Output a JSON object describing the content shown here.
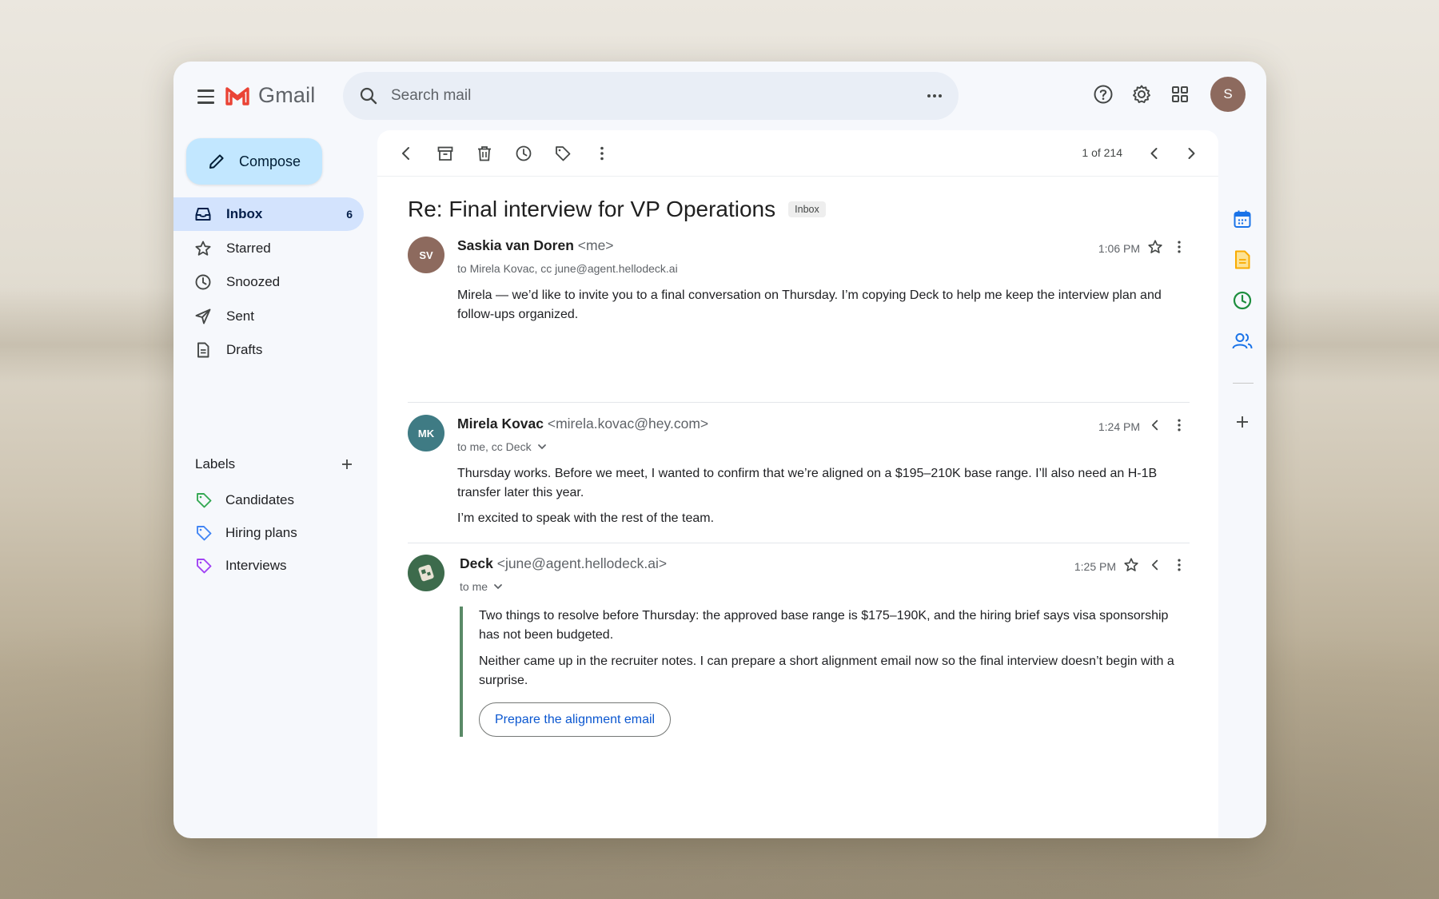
{
  "app": {
    "name": "Gmail"
  },
  "search": {
    "placeholder": "Search mail"
  },
  "user": {
    "avatar_initial": "S",
    "avatar_color": "#8d6a5e"
  },
  "compose": {
    "label": "Compose"
  },
  "nav": {
    "items": [
      {
        "label": "Inbox",
        "count": "6",
        "icon": "inbox-icon",
        "active": true
      },
      {
        "label": "Starred",
        "icon": "star-icon"
      },
      {
        "label": "Snoozed",
        "icon": "clock-icon"
      },
      {
        "label": "Sent",
        "icon": "send-icon"
      },
      {
        "label": "Drafts",
        "icon": "draft-icon"
      }
    ]
  },
  "labels": {
    "heading": "Labels",
    "items": [
      {
        "label": "Candidates",
        "color": "#34a853"
      },
      {
        "label": "Hiring plans",
        "color": "#4285f4"
      },
      {
        "label": "Interviews",
        "color": "#a142f4"
      }
    ]
  },
  "toolbar": {
    "pager": "1 of 214"
  },
  "thread": {
    "subject": "Re: Final interview for VP Operations",
    "badge": "Inbox",
    "messages": [
      {
        "initials": "SV",
        "avatar_color": "#8d6a5e",
        "sender": "Saskia van Doren",
        "address": "<me>",
        "to": "to Mirela Kovac, cc june@agent.hellodeck.ai",
        "time": "1:06 PM",
        "body": [
          "Mirela — we’d like to invite you to a final conversation on Thursday. I’m copying Deck to help me keep the interview plan and follow-ups organized."
        ]
      },
      {
        "initials": "MK",
        "avatar_color": "#3f7b84",
        "sender": "Mirela Kovac",
        "address": "<mirela.kovac@hey.com>",
        "to": "to me, cc Deck",
        "time": "1:24 PM",
        "body": [
          "Thursday works. Before we meet, I wanted to confirm that we’re aligned on a $195–210K base range. I’ll also need an H-1B transfer later this year.",
          "I’m excited to speak with the rest of the team."
        ]
      },
      {
        "avatar_color": "#3d6b4c",
        "sender": "Deck",
        "address": "<june@agent.hellodeck.ai>",
        "to": "to me",
        "time": "1:25 PM",
        "body": [
          "Two things to resolve before Thursday: the approved base range is $175–190K, and the hiring brief says visa sponsorship has not been budgeted.",
          "Neither came up in the recruiter notes. I can prepare a short alignment email now so the final interview doesn’t begin with a surprise."
        ],
        "cta": "Prepare the alignment email"
      }
    ]
  }
}
